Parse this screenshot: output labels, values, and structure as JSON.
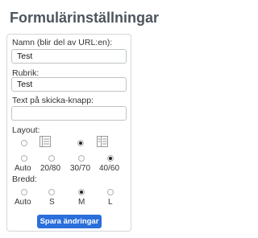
{
  "page": {
    "title": "Formulärinställningar"
  },
  "form": {
    "name_label": "Namn (blir del av URL:en):",
    "name_value": "Test",
    "heading_label": "Rubrik:",
    "heading_value": "Test",
    "submit_text_label": "Text på skicka-knapp:",
    "submit_text_value": "",
    "layout_label": "Layout:",
    "layout_options": [
      {
        "label": "Auto",
        "icon": "radio-only",
        "selected": false
      },
      {
        "label": "20/80",
        "icon": "layout-20-80-icon",
        "selected": false
      },
      {
        "label": "30/70",
        "icon": "radio-only",
        "selected": true
      },
      {
        "label": "40/60",
        "icon": "layout-40-60-icon",
        "selected": false
      }
    ],
    "layout_selected_lower_row": "40/60",
    "width_label": "Bredd:",
    "width_options": [
      {
        "label": "Auto",
        "selected": false
      },
      {
        "label": "S",
        "selected": false
      },
      {
        "label": "M",
        "selected": true
      },
      {
        "label": "L",
        "selected": false
      }
    ],
    "save_label": "Spara ändringar"
  },
  "colors": {
    "accent": "#2a6fdb",
    "title": "#4d555d",
    "border": "#d3d7da"
  }
}
